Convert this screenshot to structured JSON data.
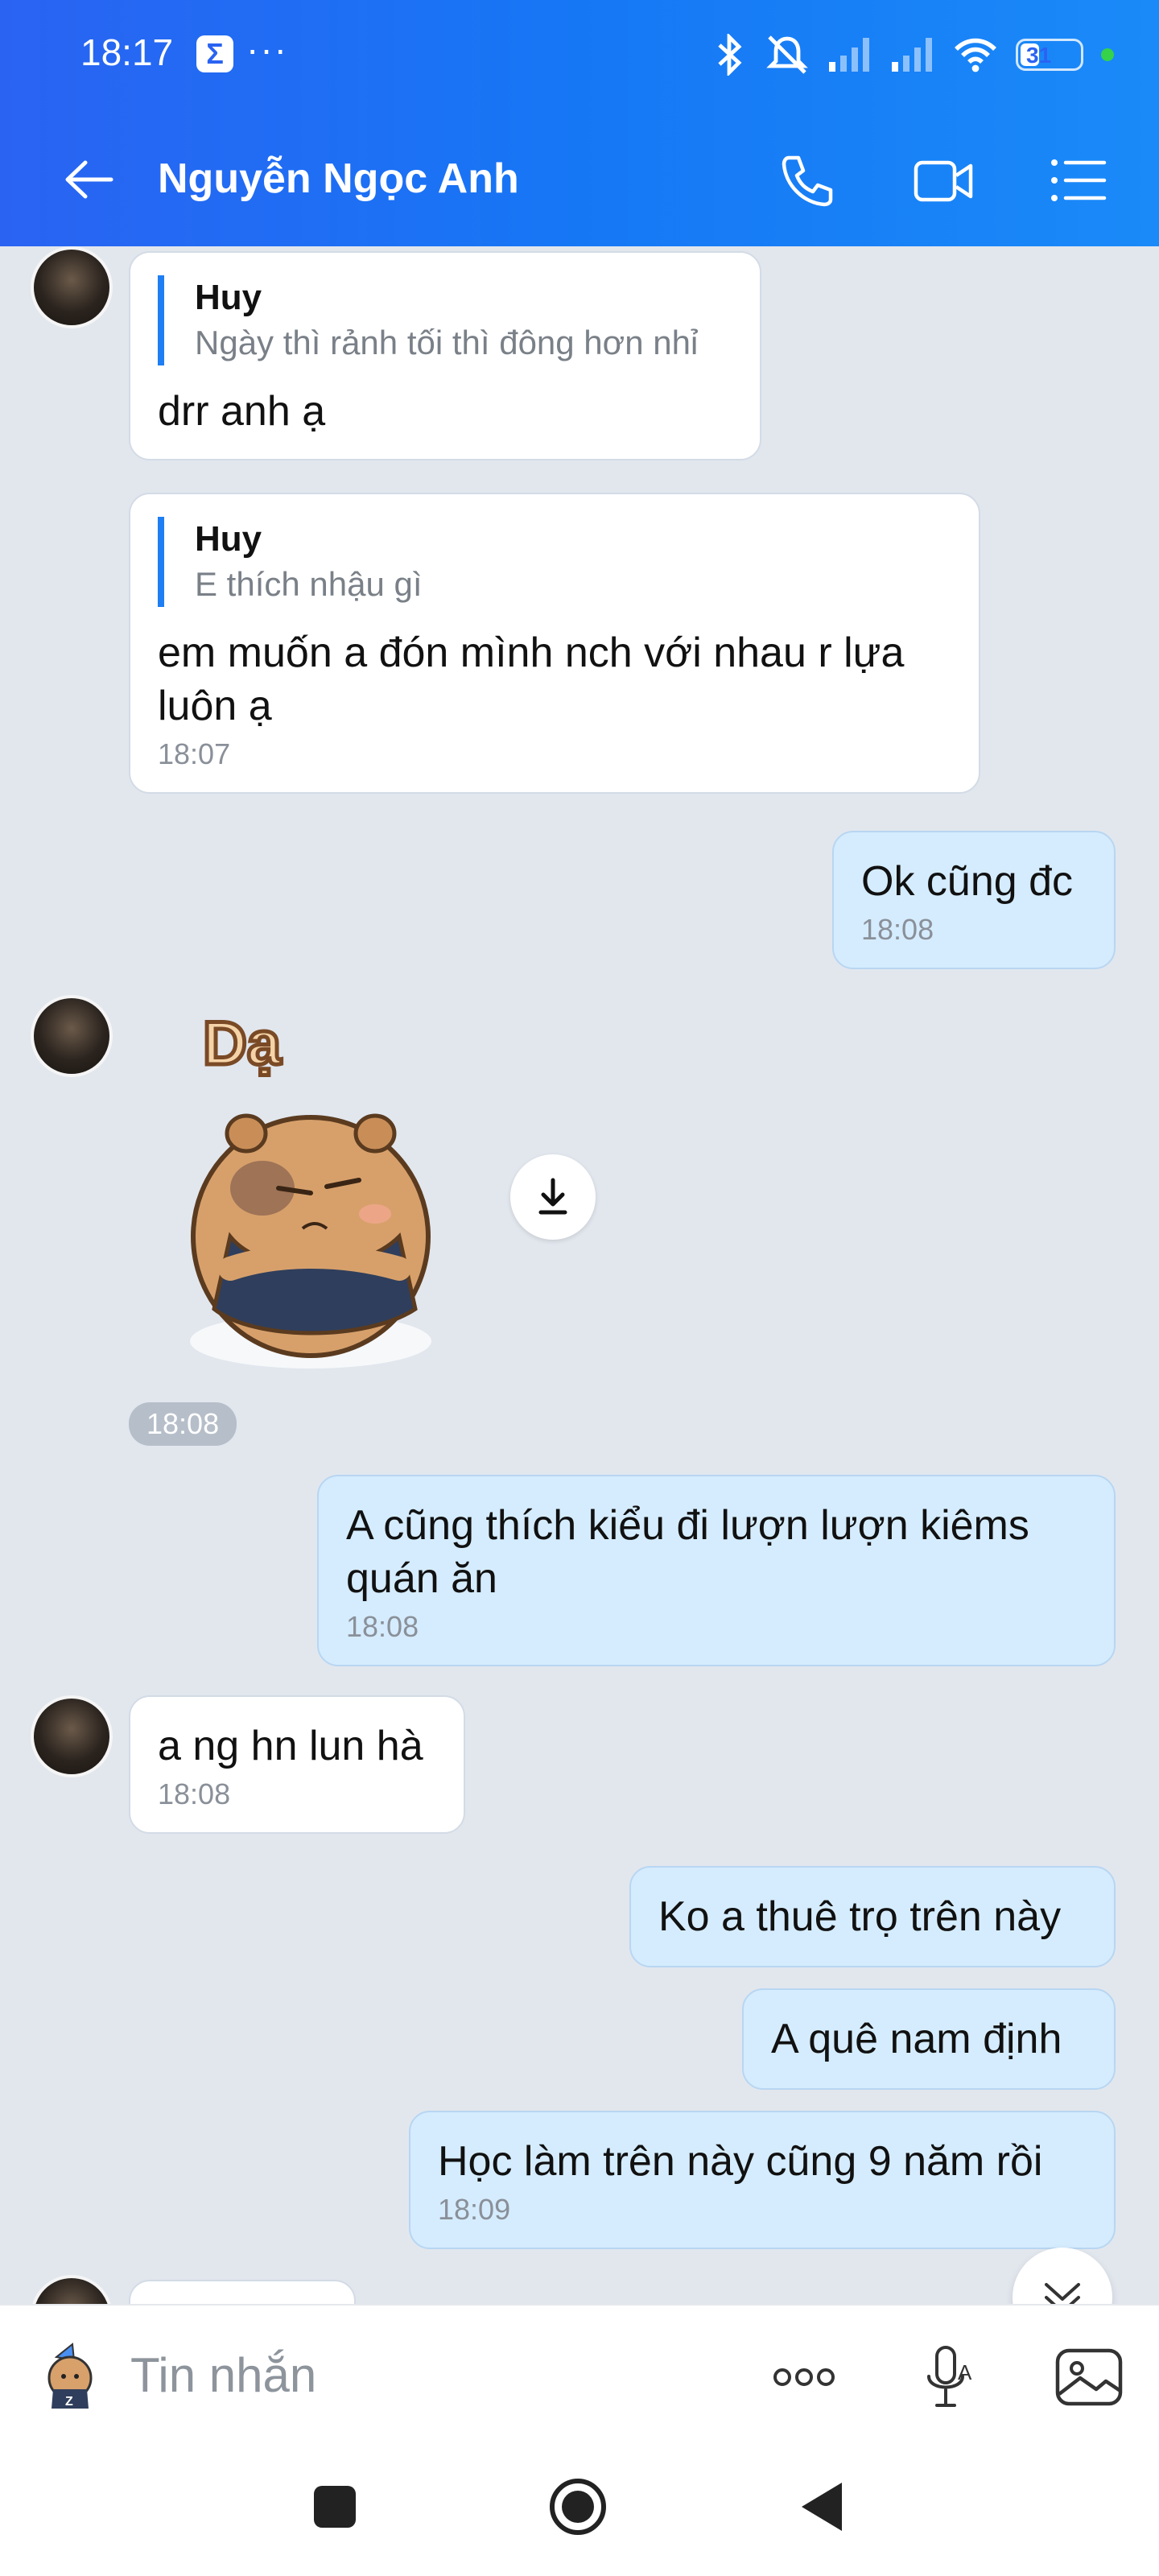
{
  "status_bar": {
    "time": "18:17",
    "sigma": "Σ",
    "more": "···",
    "battery": "31",
    "battery_level": 0.31
  },
  "header": {
    "contact_name": "Nguyễn Ngọc Anh"
  },
  "messages": {
    "m1": {
      "quote_name": "Huy",
      "quote_text": "Ngày thì rảnh tối thì đông hơn nhỉ",
      "text": "drr anh ạ"
    },
    "m2": {
      "quote_name": "Huy",
      "quote_text": "E thích nhậu gì",
      "text": "em muốn a đón mình nch với nhau r lựa luôn ạ",
      "time": "18:07"
    },
    "m3": {
      "text": "Ok cũng đc",
      "time": "18:08"
    },
    "sticker": {
      "label": "Dạ",
      "time": "18:08"
    },
    "m4": {
      "text": "A cũng thích kiểu đi lượn lượn kiêms quán ăn",
      "time": "18:08"
    },
    "m5": {
      "text": "a ng hn lun hà",
      "time": "18:08"
    },
    "m6": {
      "text": "Ko a thuê trọ trên này"
    },
    "m7": {
      "text": "A quê nam định"
    },
    "m8": {
      "text": "Học làm trên này cũng 9 năm rồi",
      "time": "18:09"
    }
  },
  "input": {
    "placeholder": "Tin nhắn"
  },
  "colors": {
    "header_start": "#2a63f2",
    "header_end": "#1a8af8",
    "my_bubble": "#d5ecfe",
    "other_bubble": "#ffffff",
    "chat_bg": "#e2e7ee",
    "quote_bar": "#1e7ef2"
  },
  "icons": [
    "back-arrow-icon",
    "phone-icon",
    "video-call-icon",
    "menu-list-icon",
    "download-icon",
    "scroll-down-icon",
    "sticker-icon",
    "more-icon",
    "voice-icon",
    "image-icon",
    "nav-square-icon",
    "nav-circle-icon",
    "nav-back-icon"
  ]
}
